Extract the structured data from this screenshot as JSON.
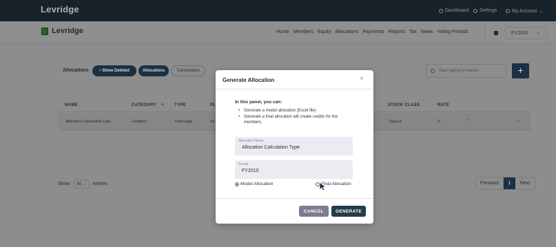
{
  "topbar": {
    "brand": "Levridge",
    "dashboard": "Dashboard",
    "settings": "Settings",
    "account": "My Account"
  },
  "header": {
    "logo_text": "Levridge",
    "nav": [
      "Home",
      "Members",
      "Equity",
      "Allocations",
      "Payments",
      "Reports",
      "Tax",
      "News",
      "Voting Periods"
    ],
    "fiscal_year": "FY2010"
  },
  "toolbar": {
    "label": "Allocations",
    "show_deleted": "Show Deleted",
    "allocations": "Allocations",
    "transactions": "Transactions",
    "search_placeholder": "Start typing to search...",
    "add": "+"
  },
  "table": {
    "headers": [
      "NAME",
      "CATEGORY",
      "TYPE",
      "PL",
      "STOCK CLASS",
      "RATE"
    ],
    "rows": [
      [
        "Allocation Calculation Type",
        "Fertilizer",
        "Patronage",
        "Se",
        "Class A",
        "0"
      ]
    ]
  },
  "footer": {
    "show_label": "Show",
    "entries_value": "50",
    "entries_label": "entries",
    "prev": "Previous",
    "current_page": "1",
    "next": "Next"
  },
  "modal": {
    "title": "Generate Allocation",
    "close": "×",
    "intro": "In this panel, you can:",
    "bullet_1": "Generate a model allocation (Excel file)",
    "bullet_2": "Generate a final allocation will create credits for the members.",
    "allocation_name_label": "Allocation Name",
    "allocation_name_value": "Allocation Calculation Type",
    "period_label": "Period",
    "period_value": "FY2010",
    "radio_model": "Model Allocation",
    "radio_final": "Final Allocation",
    "cancel": "CANCEL",
    "generate": "GENERATE"
  },
  "colors": {
    "primary": "#1b3042",
    "topbar": "#17222a",
    "cancel": "#7f7a8f",
    "generate": "#243b48"
  }
}
